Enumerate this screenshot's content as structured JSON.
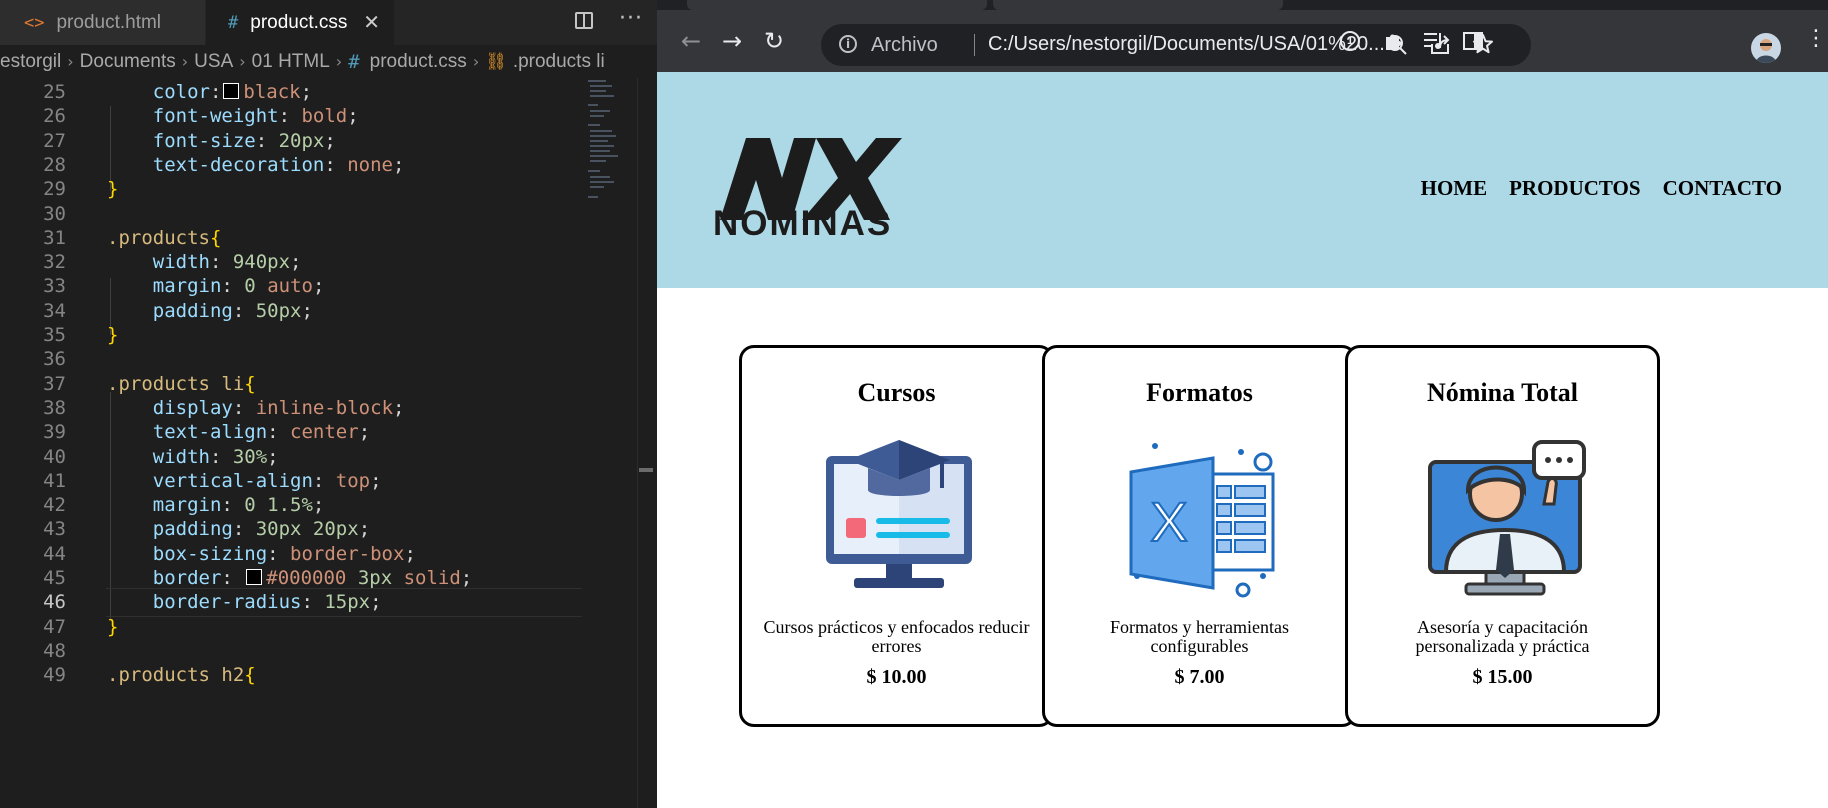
{
  "vscode": {
    "tabs": [
      {
        "icon": "<>",
        "label": "product.html"
      },
      {
        "icon": "#",
        "label": "product.css",
        "close": "✕"
      }
    ],
    "actions": {
      "more": "···"
    },
    "breadcrumb": [
      "estorgil",
      "Documents",
      "USA",
      "01 HTML",
      "product.css",
      ".products li"
    ],
    "breadcrumb_hash": "#",
    "breadcrumb_sym": "⛓",
    "active_line": "46",
    "lines": [
      {
        "n": "25",
        "parts": [
          [
            "p",
            "    color"
          ],
          [
            "c",
            ":"
          ],
          [
            "sw",
            ""
          ],
          [
            "v",
            "black"
          ],
          [
            "c",
            ";"
          ]
        ]
      },
      {
        "n": "26",
        "parts": [
          [
            "p",
            "    font-weight"
          ],
          [
            "c",
            ": "
          ],
          [
            "v",
            "bold"
          ],
          [
            "c",
            ";"
          ]
        ]
      },
      {
        "n": "27",
        "parts": [
          [
            "p",
            "    font-size"
          ],
          [
            "c",
            ": "
          ],
          [
            "n",
            "20px"
          ],
          [
            "c",
            ";"
          ]
        ]
      },
      {
        "n": "28",
        "parts": [
          [
            "p",
            "    text-decoration"
          ],
          [
            "c",
            ": "
          ],
          [
            "v",
            "none"
          ],
          [
            "c",
            ";"
          ]
        ]
      },
      {
        "n": "29",
        "parts": [
          [
            "b",
            "}"
          ]
        ]
      },
      {
        "n": "30",
        "parts": []
      },
      {
        "n": "31",
        "parts": [
          [
            "s",
            ".products"
          ],
          [
            "b",
            "{"
          ]
        ]
      },
      {
        "n": "32",
        "parts": [
          [
            "p",
            "    width"
          ],
          [
            "c",
            ": "
          ],
          [
            "n",
            "940px"
          ],
          [
            "c",
            ";"
          ]
        ]
      },
      {
        "n": "33",
        "parts": [
          [
            "p",
            "    margin"
          ],
          [
            "c",
            ": "
          ],
          [
            "n",
            "0"
          ],
          [
            "c",
            " "
          ],
          [
            "v",
            "auto"
          ],
          [
            "c",
            ";"
          ]
        ]
      },
      {
        "n": "34",
        "parts": [
          [
            "p",
            "    padding"
          ],
          [
            "c",
            ": "
          ],
          [
            "n",
            "50px"
          ],
          [
            "c",
            ";"
          ]
        ]
      },
      {
        "n": "35",
        "parts": [
          [
            "b",
            "}"
          ]
        ]
      },
      {
        "n": "36",
        "parts": []
      },
      {
        "n": "37",
        "parts": [
          [
            "s",
            ".products li"
          ],
          [
            "b",
            "{"
          ]
        ]
      },
      {
        "n": "38",
        "parts": [
          [
            "p",
            "    display"
          ],
          [
            "c",
            ": "
          ],
          [
            "v",
            "inline-block"
          ],
          [
            "c",
            ";"
          ]
        ]
      },
      {
        "n": "39",
        "parts": [
          [
            "p",
            "    text-align"
          ],
          [
            "c",
            ": "
          ],
          [
            "v",
            "center"
          ],
          [
            "c",
            ";"
          ]
        ]
      },
      {
        "n": "40",
        "parts": [
          [
            "p",
            "    width"
          ],
          [
            "c",
            ": "
          ],
          [
            "n",
            "30%"
          ],
          [
            "c",
            ";"
          ]
        ]
      },
      {
        "n": "41",
        "parts": [
          [
            "p",
            "    vertical-align"
          ],
          [
            "c",
            ": "
          ],
          [
            "v",
            "top"
          ],
          [
            "c",
            ";"
          ]
        ]
      },
      {
        "n": "42",
        "parts": [
          [
            "p",
            "    margin"
          ],
          [
            "c",
            ": "
          ],
          [
            "n",
            "0 1.5%"
          ],
          [
            "c",
            ";"
          ]
        ]
      },
      {
        "n": "43",
        "parts": [
          [
            "p",
            "    padding"
          ],
          [
            "c",
            ": "
          ],
          [
            "n",
            "30px 20px"
          ],
          [
            "c",
            ";"
          ]
        ]
      },
      {
        "n": "44",
        "parts": [
          [
            "p",
            "    box-sizing"
          ],
          [
            "c",
            ": "
          ],
          [
            "v",
            "border-box"
          ],
          [
            "c",
            ";"
          ]
        ]
      },
      {
        "n": "45",
        "parts": [
          [
            "p",
            "    border"
          ],
          [
            "c",
            ": "
          ],
          [
            "sw",
            ""
          ],
          [
            "v",
            "#000000"
          ],
          [
            "c",
            " "
          ],
          [
            "n",
            "3px"
          ],
          [
            "c",
            " "
          ],
          [
            "v",
            "solid"
          ],
          [
            "c",
            ";"
          ]
        ]
      },
      {
        "n": "46",
        "parts": [
          [
            "p",
            "    border-radius"
          ],
          [
            "c",
            ": "
          ],
          [
            "n",
            "15px"
          ],
          [
            "c",
            ";"
          ]
        ]
      },
      {
        "n": "47",
        "parts": [
          [
            "b",
            "}"
          ]
        ]
      },
      {
        "n": "48",
        "parts": []
      },
      {
        "n": "49",
        "parts": [
          [
            "s",
            ".products h2"
          ],
          [
            "b",
            "{"
          ]
        ]
      }
    ]
  },
  "browser": {
    "omnibox_label": "Archivo",
    "omnibox_url": "C:/Users/nestorgil/Documents/USA/01%20...",
    "extension_badge": "1",
    "nav_icons": {
      "back": "←",
      "forward": "→",
      "reload": "↻"
    },
    "site": {
      "logo_text": "NOMINAS",
      "nav": [
        "HOME",
        "PRODUCTOS",
        "CONTACTO"
      ],
      "products": [
        {
          "title": "Cursos",
          "desc": "Cursos prácticos y enfocados reducir errores",
          "price": "$ 10.00",
          "icon": "online-course-icon"
        },
        {
          "title": "Formatos",
          "desc": "Formatos y herramientas configurables",
          "price": "$ 7.00",
          "icon": "excel-format-icon"
        },
        {
          "title": "Nómina Total",
          "desc": "Asesoría y capacitación personalizada y práctica",
          "price": "$ 15.00",
          "icon": "consultant-icon"
        }
      ]
    }
  },
  "colors": {
    "header_bg": "#add8e6",
    "editor_bg": "#1e1e1e",
    "chrome_toolbar": "#35363a"
  }
}
